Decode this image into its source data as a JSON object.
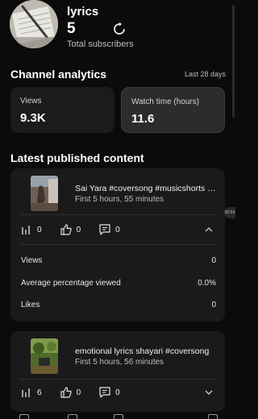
{
  "channel": {
    "name": "lyrics",
    "subscriber_count": "5",
    "subscriber_label": "Total subscribers",
    "avatar_icon": "notebook-pen-photo"
  },
  "analytics": {
    "title": "Channel analytics",
    "period": "Last 28 days",
    "cards": [
      {
        "label": "Views",
        "value": "9.3K"
      },
      {
        "label": "Watch time (hours)",
        "value": "11.6"
      }
    ]
  },
  "latest": {
    "title": "Latest published content",
    "items": [
      {
        "title": "Sai Yara #coversong #musicshorts #music",
        "meta": "First 5 hours, 55 minutes",
        "views": "0",
        "likes": "0",
        "comments": "0",
        "expanded": true,
        "details": [
          {
            "label": "Views",
            "value": "0"
          },
          {
            "label": "Average percentage viewed",
            "value": "0.0%"
          },
          {
            "label": "Likes",
            "value": "0"
          }
        ]
      },
      {
        "title": "emotional lyrics shayari #coversong",
        "meta": "First 5 hours, 56 minutes",
        "views": "6",
        "likes": "0",
        "comments": "0",
        "expanded": false
      }
    ]
  },
  "side_chip": "00:04",
  "colors": {
    "background": "#0b0b0b",
    "card": "#1a1a1a",
    "selected_card": "#2a2d2b",
    "text_secondary": "#bdbdbd"
  }
}
